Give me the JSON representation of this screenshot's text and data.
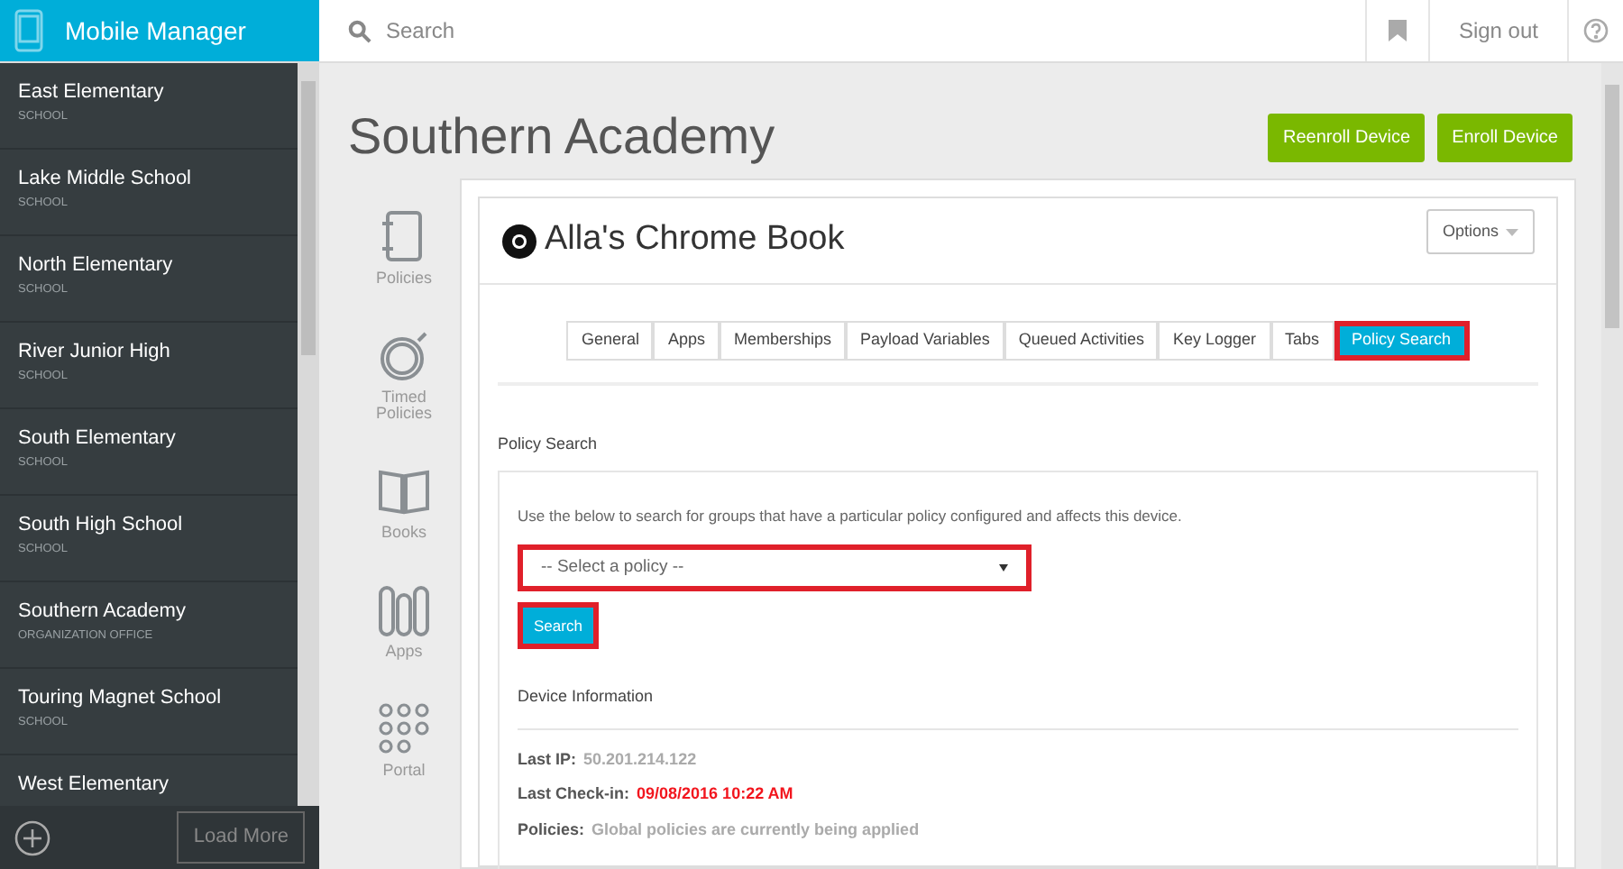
{
  "app": {
    "title": "Mobile Manager"
  },
  "search": {
    "placeholder": "Search"
  },
  "header_actions": [
    "Sign out"
  ],
  "sidebar": {
    "items": [
      {
        "name": "East Elementary",
        "type": "SCHOOL",
        "selected": false
      },
      {
        "name": "Lake Middle School",
        "type": "SCHOOL",
        "selected": false
      },
      {
        "name": "North Elementary",
        "type": "SCHOOL",
        "selected": false
      },
      {
        "name": "River Junior High",
        "type": "SCHOOL",
        "selected": false
      },
      {
        "name": "South Elementary",
        "type": "SCHOOL",
        "selected": false
      },
      {
        "name": "South High School",
        "type": "SCHOOL",
        "selected": false
      },
      {
        "name": "Southern Academy",
        "type": "ORGANIZATION OFFICE",
        "selected": false
      },
      {
        "name": "Touring Magnet School",
        "type": "SCHOOL",
        "selected": false
      },
      {
        "name": "West Elementary",
        "selected": false
      }
    ],
    "load_more": "Load More"
  },
  "page": {
    "title": "Southern Academy",
    "buttons": [
      "Reenroll Device",
      "Enroll Device"
    ]
  },
  "nav": [
    {
      "kind": "policies",
      "label": "Policies"
    },
    {
      "kind": "timed",
      "label": "Timed Policies"
    },
    {
      "kind": "books",
      "label": "Books"
    },
    {
      "kind": "apps",
      "label": "Apps"
    },
    {
      "kind": "portal",
      "label": "Portal"
    }
  ],
  "device": {
    "name": "Alla's Chrome Book",
    "options": "Options"
  },
  "tabs": [
    {
      "label": "General",
      "selected": false,
      "highlighted": false
    },
    {
      "label": "Apps",
      "selected": false,
      "highlighted": false
    },
    {
      "label": "Memberships",
      "selected": false,
      "highlighted": false
    },
    {
      "label": "Payload Variables",
      "selected": false,
      "highlighted": false
    },
    {
      "label": "Queued Activities",
      "selected": false,
      "highlighted": false
    },
    {
      "label": "Key Logger",
      "selected": false,
      "highlighted": false
    },
    {
      "label": "Tabs",
      "selected": false,
      "highlighted": false
    },
    {
      "label": "Policy Search",
      "selected": true,
      "highlighted": true
    }
  ],
  "policy_search": {
    "heading": "Policy Search",
    "description": "Use the below to search for groups that have a particular policy configured and affects this device.",
    "select": {
      "placeholder": "-- Select a policy --",
      "highlighted": true
    },
    "button": {
      "label": "Search",
      "highlighted": true
    }
  },
  "device_info": {
    "heading": "Device Information",
    "fields": [
      {
        "label": "Last IP:",
        "value": "50.201.214.122",
        "alert": false
      },
      {
        "label": "Last Check-in:",
        "value": "09/08/2016 10:22 AM",
        "alert": true
      },
      {
        "label": "Policies:",
        "value": "Global policies are currently being applied",
        "alert": false
      }
    ]
  }
}
